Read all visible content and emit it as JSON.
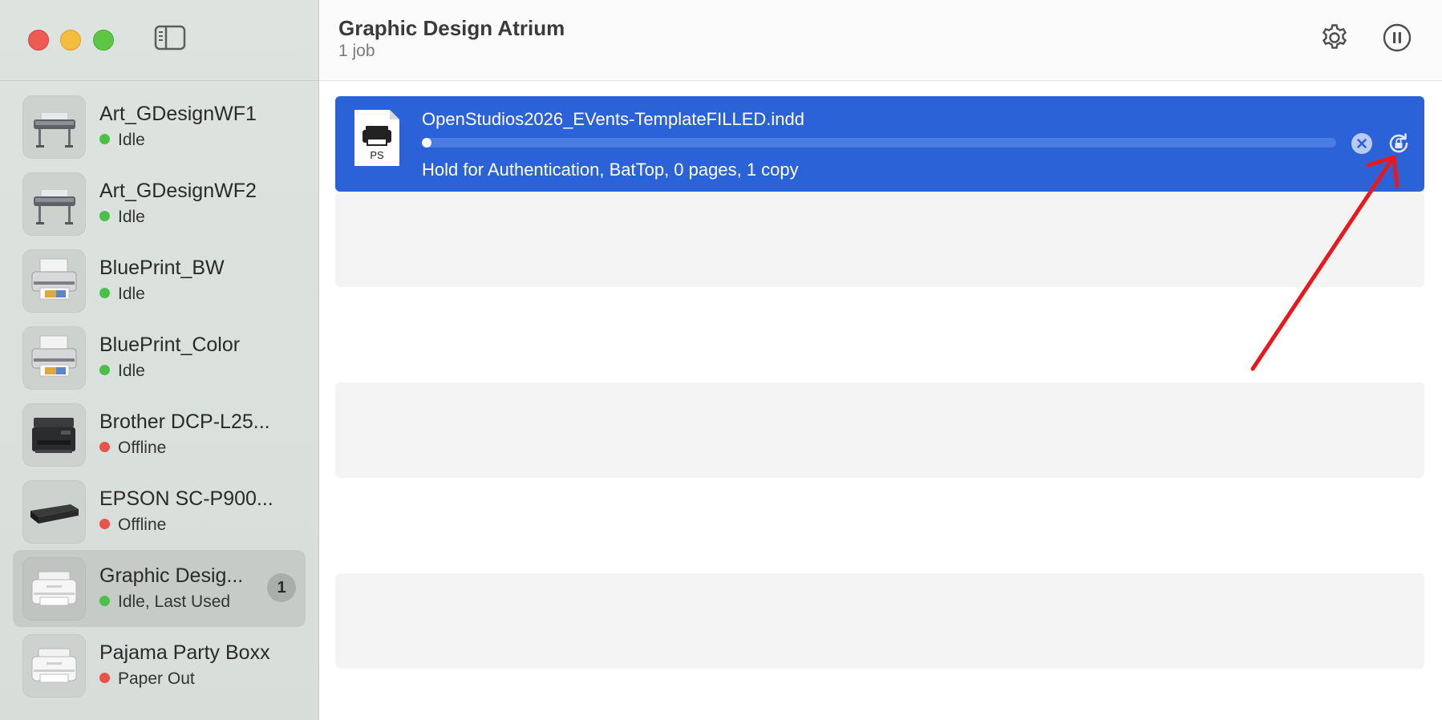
{
  "window": {
    "title": "Graphic Design Atrium",
    "subtitle": "1 job"
  },
  "sidebar": {
    "items": [
      {
        "name": "Art_GDesignWF1",
        "status": "Idle",
        "status_color": "#4ac04b",
        "icon": "wide-format-printer-icon"
      },
      {
        "name": "Art_GDesignWF2",
        "status": "Idle",
        "status_color": "#4ac04b",
        "icon": "wide-format-printer-icon"
      },
      {
        "name": "BluePrint_BW",
        "status": "Idle",
        "status_color": "#4ac04b",
        "icon": "photo-printer-icon"
      },
      {
        "name": "BluePrint_Color",
        "status": "Idle",
        "status_color": "#4ac04b",
        "icon": "photo-printer-icon"
      },
      {
        "name": "Brother DCP-L25...",
        "status": "Offline",
        "status_color": "#e8534d",
        "icon": "multifunction-printer-icon"
      },
      {
        "name": "EPSON SC-P900...",
        "status": "Offline",
        "status_color": "#e8534d",
        "icon": "black-printer-icon"
      },
      {
        "name": "Graphic Desig...",
        "status": "Idle, Last Used",
        "status_color": "#4ac04b",
        "icon": "generic-printer-icon",
        "badge": "1",
        "selected": true
      },
      {
        "name": "Pajama Party Boxx",
        "status": "Paper Out",
        "status_color": "#e8534d",
        "icon": "generic-printer-icon"
      }
    ]
  },
  "jobs": [
    {
      "name": "OpenStudios2026_EVents-TemplateFILLED.indd",
      "details": "Hold for Authentication, BatTop, 0 pages, 1 copy",
      "doc_type": "PS",
      "progress": 0.01
    }
  ],
  "colors": {
    "accent": "#2c62d8",
    "annotation": "#e8191c"
  }
}
